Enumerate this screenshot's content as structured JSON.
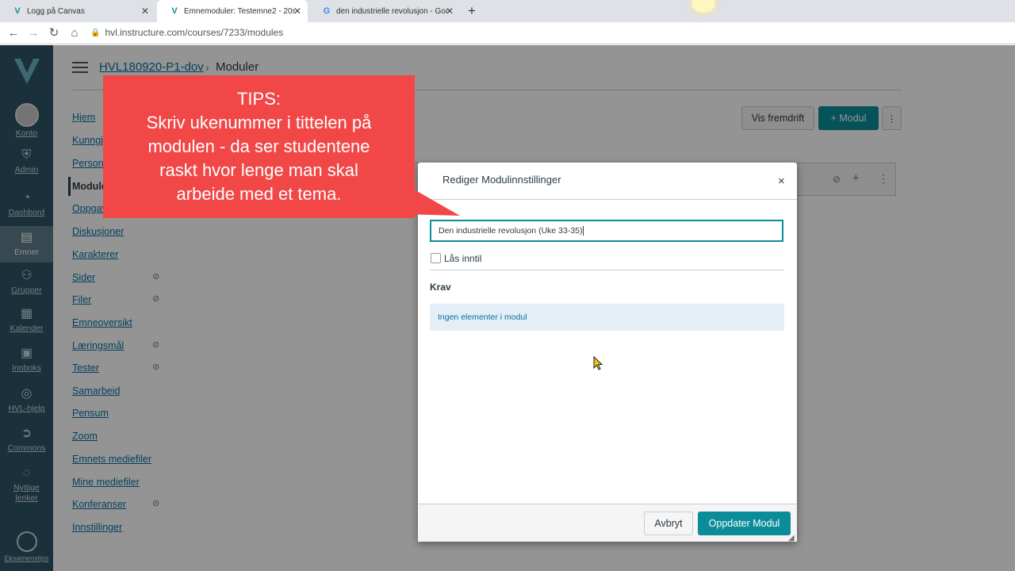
{
  "browser": {
    "tabs": [
      {
        "title": "Logg på Canvas",
        "icon": "canvas-v-icon"
      },
      {
        "title": "Emnemoduler: Testemne2 - 20se",
        "icon": "canvas-v-icon"
      },
      {
        "title": "den industrielle revolusjon - Goo",
        "icon": "google-g-icon"
      }
    ],
    "new_tab": "+",
    "url": "hvl.instructure.com/courses/7233/modules"
  },
  "global_nav": {
    "items": [
      {
        "label": "Konto",
        "icon": "avatar"
      },
      {
        "label": "Admin",
        "icon": "shield-icon"
      },
      {
        "label": "Dashbord",
        "icon": "dashboard-icon"
      },
      {
        "label": "Emner",
        "icon": "book-icon"
      },
      {
        "label": "Grupper",
        "icon": "people-icon"
      },
      {
        "label": "Kalender",
        "icon": "calendar-icon"
      },
      {
        "label": "Innboks",
        "icon": "inbox-icon"
      },
      {
        "label": "HVL-hjelp",
        "icon": "help-icon"
      },
      {
        "label": "Commons",
        "icon": "commons-icon"
      },
      {
        "label": "Nyttige lenker",
        "icon": "lightbulb-icon"
      },
      {
        "label": "Eksamenstips",
        "icon": "badge-icon"
      }
    ]
  },
  "breadcrumb": {
    "course": "HVL180920-P1-dov",
    "separator": "›",
    "page": "Moduler"
  },
  "course_nav": [
    {
      "label": "Hjem"
    },
    {
      "label": "Kunngj"
    },
    {
      "label": "Person"
    },
    {
      "label": "Moduler"
    },
    {
      "label": "Oppgav"
    },
    {
      "label": "Diskusjoner"
    },
    {
      "label": "Karakterer"
    },
    {
      "label": "Sider",
      "hidden": true
    },
    {
      "label": "Filer",
      "hidden": true
    },
    {
      "label": "Emneoversikt"
    },
    {
      "label": "Læringsmål",
      "hidden": true
    },
    {
      "label": "Tester",
      "hidden": true
    },
    {
      "label": "Samarbeid"
    },
    {
      "label": "Pensum"
    },
    {
      "label": "Zoom"
    },
    {
      "label": "Emnets mediefiler"
    },
    {
      "label": "Mine mediefiler"
    },
    {
      "label": "Konferanser",
      "hidden": true
    },
    {
      "label": "Innstillinger"
    }
  ],
  "module_toolbar": {
    "progress": "Vis fremdrift",
    "add_module": "+ Modul",
    "more": "⋮"
  },
  "modal": {
    "title": "Rediger Modulinnstillinger",
    "close": "×",
    "name_value": "Den industrielle revolusjon (Uke 33-35)",
    "lock_label": "Lås inntil",
    "requirements_heading": "Krav",
    "empty_message": "Ingen elementer i modul",
    "cancel": "Avbryt",
    "submit": "Oppdater Modul"
  },
  "tip": {
    "heading": "TIPS:",
    "lines": [
      "Skriv ukenummer i tittelen på",
      "modulen - da ser studentene",
      "raskt hvor lenge man skal",
      "arbeide med et tema."
    ]
  },
  "colors": {
    "accent": "#0b8d99",
    "nav_bg": "#2e5464",
    "tip_bg": "#f24747",
    "link": "#0770a3"
  }
}
